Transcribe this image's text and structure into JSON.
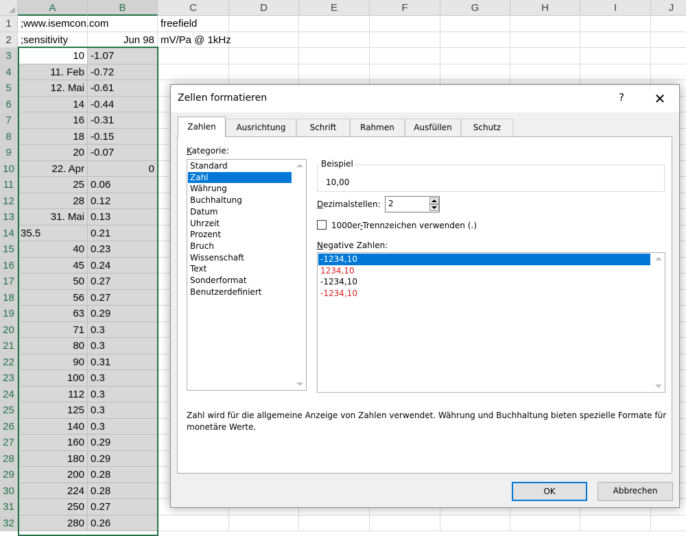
{
  "sheet": {
    "columns": [
      "A",
      "B",
      "C",
      "D",
      "E",
      "F",
      "G",
      "H",
      "I",
      "J"
    ],
    "rows": [
      {
        "n": "1",
        "a": ";www.isemcon.com",
        "b": "",
        "c": "freefield"
      },
      {
        "n": "2",
        "a": ";sensitivity",
        "b": "Jun 98",
        "c": "mV/Pa @ 1kHz"
      },
      {
        "n": "3",
        "a": "10",
        "b": "-1.07"
      },
      {
        "n": "4",
        "a": "11. Feb",
        "b": "-0.72"
      },
      {
        "n": "5",
        "a": "12. Mai",
        "b": "-0.61"
      },
      {
        "n": "6",
        "a": "14",
        "b": "-0.44"
      },
      {
        "n": "7",
        "a": "16",
        "b": "-0.31"
      },
      {
        "n": "8",
        "a": "18",
        "b": "-0.15"
      },
      {
        "n": "9",
        "a": "20",
        "b": "-0.07"
      },
      {
        "n": "10",
        "a": "22. Apr",
        "b": "0"
      },
      {
        "n": "11",
        "a": "25",
        "b": "0.06"
      },
      {
        "n": "12",
        "a": "28",
        "b": "0.12"
      },
      {
        "n": "13",
        "a": "31. Mai",
        "b": "0.13"
      },
      {
        "n": "14",
        "a": "35.5",
        "b": "0.21"
      },
      {
        "n": "15",
        "a": "40",
        "b": "0.23"
      },
      {
        "n": "16",
        "a": "45",
        "b": "0.24"
      },
      {
        "n": "17",
        "a": "50",
        "b": "0.27"
      },
      {
        "n": "18",
        "a": "56",
        "b": "0.27"
      },
      {
        "n": "19",
        "a": "63",
        "b": "0.29"
      },
      {
        "n": "20",
        "a": "71",
        "b": "0.3"
      },
      {
        "n": "21",
        "a": "80",
        "b": "0.3"
      },
      {
        "n": "22",
        "a": "90",
        "b": "0.31"
      },
      {
        "n": "23",
        "a": "100",
        "b": "0.3"
      },
      {
        "n": "24",
        "a": "112",
        "b": "0.3"
      },
      {
        "n": "25",
        "a": "125",
        "b": "0.3"
      },
      {
        "n": "26",
        "a": "140",
        "b": "0.3"
      },
      {
        "n": "27",
        "a": "160",
        "b": "0.29"
      },
      {
        "n": "28",
        "a": "180",
        "b": "0.29"
      },
      {
        "n": "29",
        "a": "200",
        "b": "0.28"
      },
      {
        "n": "30",
        "a": "224",
        "b": "0.28"
      },
      {
        "n": "31",
        "a": "250",
        "b": "0.27"
      },
      {
        "n": "32",
        "a": "280",
        "b": "0.26"
      }
    ]
  },
  "dialog": {
    "title": "Zellen formatieren",
    "help": "?",
    "close": "✕",
    "tabs": [
      "Zahlen",
      "Ausrichtung",
      "Schrift",
      "Rahmen",
      "Ausfüllen",
      "Schutz"
    ],
    "kategorie_label": "Kategorie:",
    "categories": [
      "Standard",
      "Zahl",
      "Währung",
      "Buchhaltung",
      "Datum",
      "Uhrzeit",
      "Prozent",
      "Bruch",
      "Wissenschaft",
      "Text",
      "Sonderformat",
      "Benutzerdefiniert"
    ],
    "beispiel_label": "Beispiel",
    "beispiel_value": "10,00",
    "dezimal_label": "Dezimalstellen:",
    "dezimal_value": "2",
    "thousands_label": "1000er-Trennzeichen verwenden (.)",
    "negative_label": "Negative Zahlen:",
    "negative_options": [
      {
        "text": "-1234,10",
        "red": false
      },
      {
        "text": "1234,10",
        "red": true
      },
      {
        "text": "-1234,10",
        "red": false
      },
      {
        "text": "-1234,10",
        "red": true
      }
    ],
    "description": "Zahl wird für die allgemeine Anzeige von Zahlen verwendet. Währung und Buchhaltung bieten spezielle Formate für monetäre Werte.",
    "ok": "OK",
    "cancel": "Abbrechen"
  },
  "colors": {
    "excel_green": "#217346",
    "selection_blue": "#0078d7",
    "negative_red": "#e02020"
  }
}
